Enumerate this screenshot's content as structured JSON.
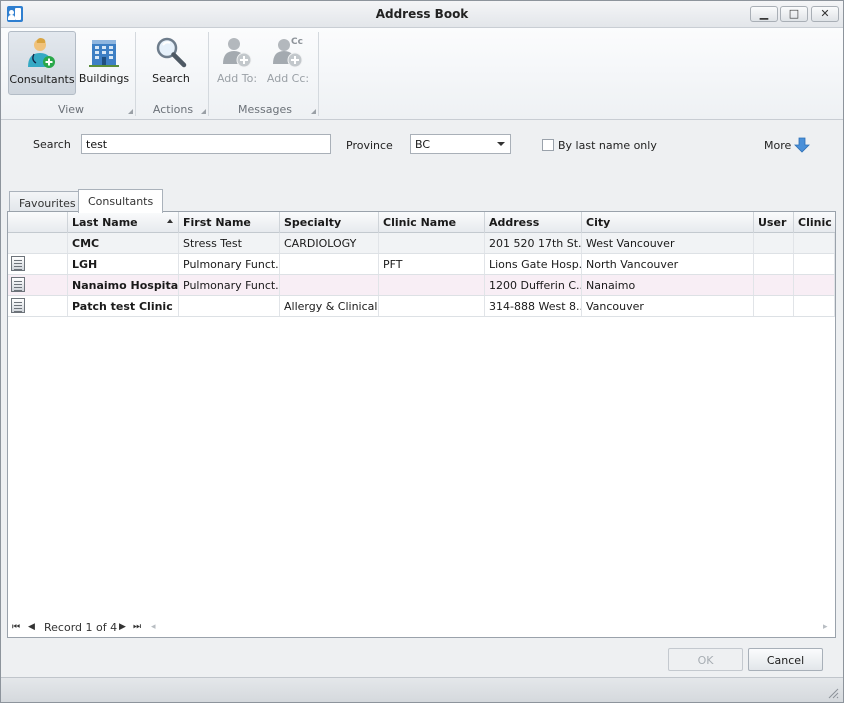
{
  "window": {
    "title": "Address Book",
    "controls": {
      "minimize": "▁",
      "maximize": "□",
      "close": "✕"
    }
  },
  "ribbon": {
    "groups": [
      {
        "label": "View",
        "buttons": [
          {
            "label": "Consultants",
            "icon": "consultant-icon",
            "active": true
          },
          {
            "label": "Buildings",
            "icon": "building-icon"
          }
        ]
      },
      {
        "label": "Actions",
        "buttons": [
          {
            "label": "Search",
            "icon": "magnifier-icon"
          }
        ]
      },
      {
        "label": "Messages",
        "buttons": [
          {
            "label": "Add To:",
            "icon": "add-person-icon",
            "disabled": true
          },
          {
            "label": "Add Cc:",
            "icon": "add-cc-icon",
            "disabled": true
          }
        ]
      }
    ]
  },
  "search": {
    "label": "Search",
    "value": "test",
    "province_label": "Province",
    "province_value": "BC",
    "last_name_only_label": "By last name only",
    "last_name_only_checked": false,
    "more_label": "More"
  },
  "tabs": [
    {
      "label": "Favourites",
      "active": false
    },
    {
      "label": "Consultants",
      "active": true
    }
  ],
  "grid": {
    "columns": [
      "",
      "Last Name",
      "First Name",
      "Specialty",
      "Clinic Name",
      "Address",
      "City",
      "User",
      "Clinic"
    ],
    "sorted_column": "Last Name",
    "rows": [
      {
        "last": "CMC",
        "first": "Stress Test",
        "specialty": "CARDIOLOGY",
        "clinic": "",
        "address": "201 520 17th St...",
        "city": "West Vancouver",
        "user": "",
        "clinic2": "",
        "icon": false
      },
      {
        "last": "LGH",
        "first": "Pulmonary Funct...",
        "specialty": "",
        "clinic": "PFT",
        "address": "Lions Gate Hosp...",
        "city": "North Vancouver",
        "user": "",
        "clinic2": "",
        "icon": true
      },
      {
        "last": "Nanaimo Hospital",
        "first": "Pulmonary Funct...",
        "specialty": "",
        "clinic": "",
        "address": "1200 Dufferin C...",
        "city": "Nanaimo",
        "user": "",
        "clinic2": "",
        "icon": true
      },
      {
        "last": "Patch test Clinic",
        "first": "",
        "specialty": "Allergy & Clinical...",
        "clinic": "",
        "address": "314-888 West 8...",
        "city": "Vancouver",
        "user": "",
        "clinic2": "",
        "icon": true
      }
    ],
    "navigator": {
      "record_text": "Record 1 of 4"
    }
  },
  "footer": {
    "ok_label": "OK",
    "cancel_label": "Cancel"
  },
  "colors": {
    "accent": "#2f7fd0",
    "selected_row": "#f8eef5"
  }
}
